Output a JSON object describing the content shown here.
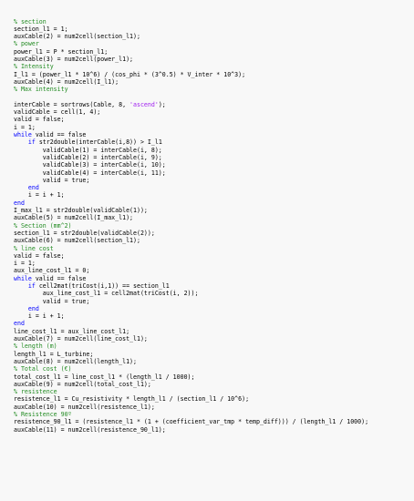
{
  "editor": {
    "lines": [
      [
        {
          "t": "% section",
          "c": "c"
        }
      ],
      [
        {
          "t": "section_l1 = 1;"
        }
      ],
      [
        {
          "t": "auxCable(2) = num2cell(section_l1);"
        }
      ],
      [
        {
          "t": "% power",
          "c": "c"
        }
      ],
      [
        {
          "t": "power_l1 = P * section_l1;"
        }
      ],
      [
        {
          "t": "auxCable(3) = num2cell(power_l1);"
        }
      ],
      [
        {
          "t": "% Intensity",
          "c": "c"
        }
      ],
      [
        {
          "t": "I_l1 = (power_l1 * 10^6) / (cos_phi * (3^0.5) * V_inter * 10^3);"
        }
      ],
      [
        {
          "t": "auxCable(4) = num2cell(I_l1);"
        }
      ],
      [
        {
          "t": "% Max intensity",
          "c": "c"
        }
      ],
      [
        {
          "t": ""
        }
      ],
      [
        {
          "t": "interCable = sortrows(Cable, 8, "
        },
        {
          "t": "'ascend'",
          "c": "s"
        },
        {
          "t": ");"
        }
      ],
      [
        {
          "t": "validCable = cell(1, 4);"
        }
      ],
      [
        {
          "t": "valid = false;"
        }
      ],
      [
        {
          "t": "i = 1;"
        }
      ],
      [
        {
          "t": "while",
          "c": "k"
        },
        {
          "t": " valid == false"
        }
      ],
      [
        {
          "t": "    "
        },
        {
          "t": "if",
          "c": "k"
        },
        {
          "t": " str2double(interCable(i,8)) > I_l1"
        }
      ],
      [
        {
          "t": "        validCable(1) = interCable(i, 8);"
        }
      ],
      [
        {
          "t": "        validCable(2) = interCable(i, 9);"
        }
      ],
      [
        {
          "t": "        validCable(3) = interCable(i, 10);"
        }
      ],
      [
        {
          "t": "        validCable(4) = interCable(i, 11);"
        }
      ],
      [
        {
          "t": "        valid = true;"
        }
      ],
      [
        {
          "t": "    "
        },
        {
          "t": "end",
          "c": "k"
        }
      ],
      [
        {
          "t": "    i = i + 1;"
        }
      ],
      [
        {
          "t": "end",
          "c": "k"
        }
      ],
      [
        {
          "t": "I_max_l1 = str2double(validCable(1));"
        }
      ],
      [
        {
          "t": "auxCable(5) = num2cell(I_max_l1);"
        }
      ],
      [
        {
          "t": "% Section (mm^2)",
          "c": "c"
        }
      ],
      [
        {
          "t": "section_l1 = str2double(validCable(2));"
        }
      ],
      [
        {
          "t": "auxCable(6) = num2cell(section_l1);"
        }
      ],
      [
        {
          "t": "% line cost",
          "c": "c"
        }
      ],
      [
        {
          "t": "valid = false;"
        }
      ],
      [
        {
          "t": "i = 1;"
        }
      ],
      [
        {
          "t": "aux_line_cost_l1 = 0;"
        }
      ],
      [
        {
          "t": "while",
          "c": "k"
        },
        {
          "t": " valid == false"
        }
      ],
      [
        {
          "t": "    "
        },
        {
          "t": "if",
          "c": "k"
        },
        {
          "t": " cell2mat(triCost(i,1)) == section_l1"
        }
      ],
      [
        {
          "t": "        aux_line_cost_l1 = cell2mat(triCost(i, 2));"
        }
      ],
      [
        {
          "t": "        valid = true;"
        }
      ],
      [
        {
          "t": "    "
        },
        {
          "t": "end",
          "c": "k"
        }
      ],
      [
        {
          "t": "    i = i + 1;"
        }
      ],
      [
        {
          "t": "end",
          "c": "k"
        }
      ],
      [
        {
          "t": "line_cost_l1 = aux_line_cost_l1;"
        }
      ],
      [
        {
          "t": "auxCable(7) = num2cell(line_cost_l1);"
        }
      ],
      [
        {
          "t": "% length (m)",
          "c": "c"
        }
      ],
      [
        {
          "t": "length_l1 = L_turbine;"
        }
      ],
      [
        {
          "t": "auxCable(8) = num2cell(length_l1);"
        }
      ],
      [
        {
          "t": "% Total cost (€)",
          "c": "c"
        }
      ],
      [
        {
          "t": "total_cost_l1 = line_cost_l1 * (length_l1 / 1000);"
        }
      ],
      [
        {
          "t": "auxCable(9) = num2cell(total_cost_l1);"
        }
      ],
      [
        {
          "t": "% resistence",
          "c": "c"
        }
      ],
      [
        {
          "t": "resistence_l1 = Cu_resistivity * length_l1 / (section_l1 / 10^6);"
        }
      ],
      [
        {
          "t": "auxCable(10) = num2cell(resistence_l1);"
        }
      ],
      [
        {
          "t": "% Resistence 90º",
          "c": "c"
        }
      ],
      [
        {
          "t": "resistence_90_l1 = (resistence_l1 * (1 + (coefficient_var_tmp * temp_diff))) / (length_l1 / 1000);"
        }
      ],
      [
        {
          "t": "auxCable(11) = num2cell(resistence_90_l1);"
        }
      ]
    ],
    "colors": {
      "background": "#f8f8f8",
      "text": "#000000",
      "comment": "#228b22",
      "keyword": "#0000ff",
      "string": "#a020f0"
    }
  }
}
